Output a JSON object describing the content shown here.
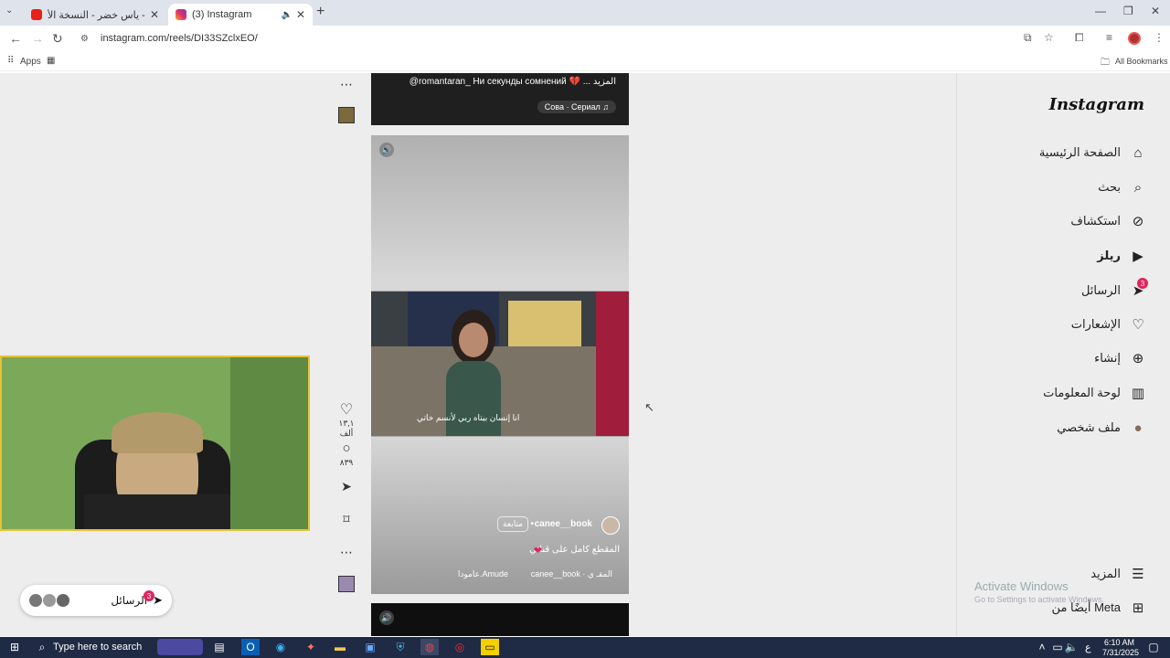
{
  "browser": {
    "tabs": [
      {
        "title": "اه يا ليل - ياس خضر - النسخة الأ",
        "active": false
      },
      {
        "title": "(3) Instagram",
        "active": true
      }
    ],
    "url": "instagram.com/reels/DI33SZclxEO/",
    "bookmarks": {
      "apps": "Apps",
      "all": "All Bookmarks"
    }
  },
  "instagram": {
    "brand": "Instagram",
    "nav": [
      {
        "label": "الصفحة الرئيسية",
        "icon": "home-icon"
      },
      {
        "label": "بحث",
        "icon": "search-icon"
      },
      {
        "label": "استكشاف",
        "icon": "compass-icon"
      },
      {
        "label": "ريلز",
        "icon": "reels-icon"
      },
      {
        "label": "الرسائل",
        "icon": "messenger-icon",
        "badge": "3"
      },
      {
        "label": "الإشعارات",
        "icon": "heart-icon"
      },
      {
        "label": "إنشاء",
        "icon": "plus-icon"
      },
      {
        "label": "لوحة المعلومات",
        "icon": "dashboard-icon"
      },
      {
        "label": "ملف شخصي",
        "icon": "avatar-icon"
      }
    ],
    "more": "المزيد",
    "also_meta": "أيضًا من Meta",
    "prev_reel": {
      "caption": "@romantaran_ Ни секунды сомнений 💔 ... المزيد",
      "audio": "Сова · Сериал ♫"
    },
    "reel": {
      "overlay_text": "انا إنسان بيتاه ربي لأنسم خاتي",
      "username": "canee__book",
      "follow": "متابعة",
      "caption": "المقطع كامل على قناتي",
      "location": "عامودا.Amude",
      "audio": "canee__book · المقـ ي"
    },
    "actions": {
      "likes": "١٣,١ ألف",
      "comments": "٨٣٩"
    },
    "messages_pill": {
      "label": "الرسائل",
      "badge": "3"
    }
  },
  "watermark": {
    "line1": "Activate Windows",
    "line2": "Go to Settings to activate Windows."
  },
  "taskbar": {
    "search": "Type here to search",
    "time": "6:10 AM",
    "date": "7/31/2025",
    "lang": "ع"
  }
}
